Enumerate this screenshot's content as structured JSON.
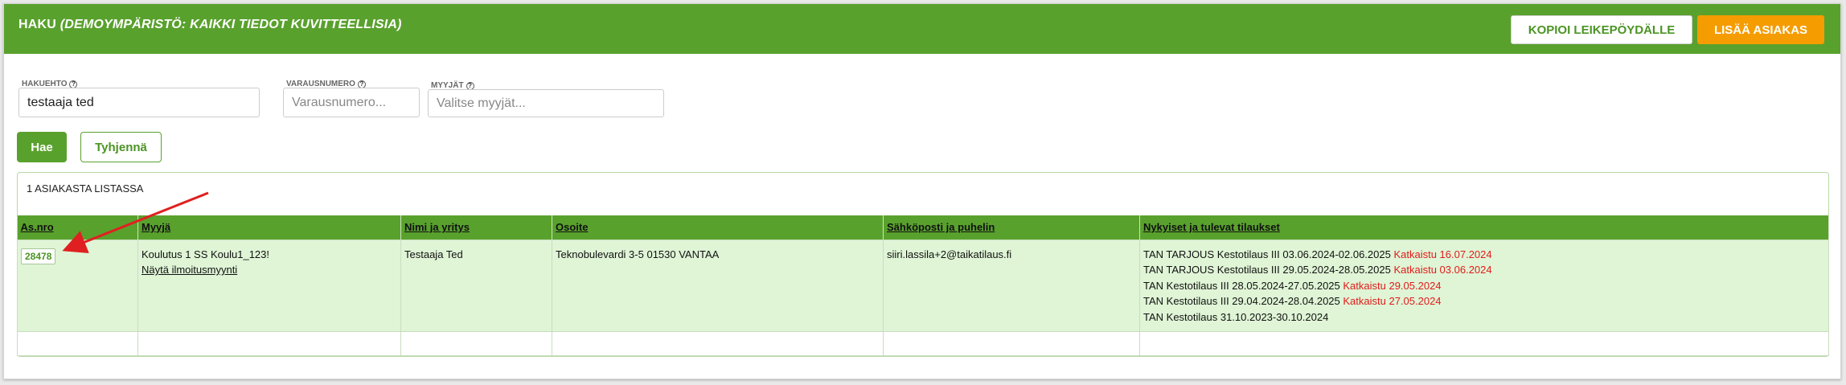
{
  "header": {
    "title": "HAKU",
    "subtitle": "(DEMOYMPÄRISTÖ: KAIKKI TIEDOT KUVITTEELLISIA)",
    "copy_button": "KOPIOI LEIKEPÖYDÄLLE",
    "add_customer_button": "LISÄÄ ASIAKAS",
    "color_primary": "#59a12d",
    "color_accent": "#f59c00"
  },
  "search": {
    "criteria_label": "HAKUEHTO",
    "criteria_value": "testaaja ted",
    "booking_label": "VARAUSNUMERO",
    "booking_placeholder": "Varausnumero...",
    "sellers_label": "MYYJÄT",
    "sellers_placeholder": "Valitse myyjät...",
    "search_button": "Hae",
    "clear_button": "Tyhjennä"
  },
  "results": {
    "count_text": "1 ASIAKASTA LISTASSA",
    "columns": [
      "As.nro",
      "Myyjä",
      "Nimi ja yritys",
      "Osoite",
      "Sähköposti ja puhelin",
      "Nykyiset ja tulevat tilaukset"
    ],
    "rows": [
      {
        "customer_number": "28478",
        "seller": "Koulutus 1 SS Koulu1_123!",
        "seller_link": "Näytä ilmoitusmyynti",
        "name": "Testaaja Ted",
        "address": "Teknobulevardi 3-5 01530 VANTAA",
        "contact": "siiri.lassila+2@taikatilaus.fi",
        "orders": [
          {
            "text": "TAN TARJOUS Kestotilaus III 03.06.2024-02.06.2025",
            "status": "Katkaistu 16.07.2024"
          },
          {
            "text": "TAN TARJOUS Kestotilaus III 29.05.2024-28.05.2025",
            "status": "Katkaistu 03.06.2024"
          },
          {
            "text": "TAN Kestotilaus III 28.05.2024-27.05.2025",
            "status": "Katkaistu 29.05.2024"
          },
          {
            "text": "TAN Kestotilaus III 29.04.2024-28.04.2025",
            "status": "Katkaistu 27.05.2024"
          },
          {
            "text": "TAN Kestotilaus 31.10.2023-30.10.2024",
            "status": ""
          }
        ]
      }
    ]
  }
}
